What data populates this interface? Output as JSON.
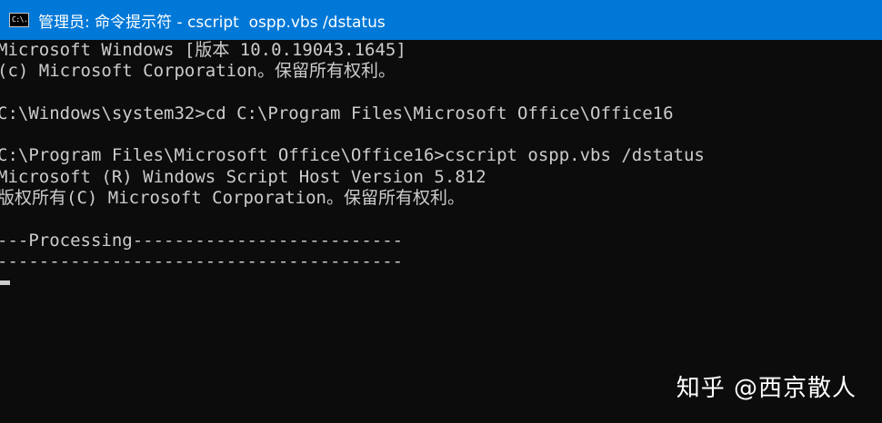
{
  "window": {
    "title": "管理员: 命令提示符 - cscript  ospp.vbs /dstatus",
    "icon": "cmd-icon",
    "icon_text": "C:\\."
  },
  "console": {
    "lines": [
      "Microsoft Windows [版本 10.0.19043.1645]",
      "(c) Microsoft Corporation。保留所有权利。",
      "",
      "C:\\Windows\\system32>cd C:\\Program Files\\Microsoft Office\\Office16",
      "",
      "C:\\Program Files\\Microsoft Office\\Office16>cscript ospp.vbs /dstatus",
      "Microsoft (R) Windows Script Host Version 5.812",
      "版权所有(C) Microsoft Corporation。保留所有权利。",
      "",
      "---Processing--------------------------",
      "---------------------------------------"
    ]
  },
  "watermark": {
    "text": "知乎 @西京散人"
  },
  "colors": {
    "titlebar_bg": "#0078d7",
    "console_bg": "#0c0c0c",
    "console_fg": "#cccccc"
  }
}
